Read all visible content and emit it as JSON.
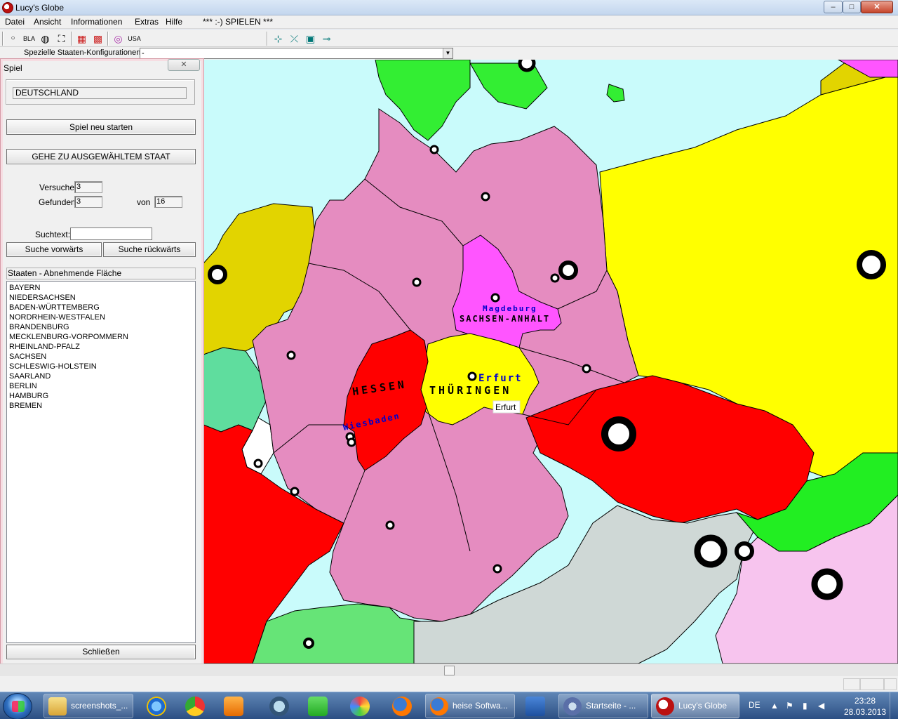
{
  "window": {
    "title": "Lucy's Globe",
    "minimize_glyph": "–",
    "maximize_glyph": "□",
    "close_glyph": "✕"
  },
  "menu": {
    "items": [
      "Datei",
      "Ansicht",
      "Informationen",
      "Extras",
      "Hilfe",
      "*** :-) SPIELEN ***"
    ]
  },
  "toolbar": {
    "buttons": [
      "○",
      "BLA",
      "◍",
      "⛶",
      "▦",
      "▩",
      "◎",
      "USA",
      "⊹",
      "⤫",
      "▣",
      "⊸"
    ]
  },
  "config": {
    "label": "Spezielle Staaten-Konfigurationen:",
    "value": "-",
    "arrow": "▼"
  },
  "panel": {
    "title": "Spiel",
    "close_glyph": "✕",
    "country": "DEUTSCHLAND",
    "restart_button": "Spiel neu starten",
    "goto_button": "GEHE ZU AUSGEWÄHLTEM STAAT",
    "attempts_label": "Versuche",
    "attempts_value": "3",
    "found_label": "Gefunden",
    "found_value": "3",
    "of_label": "von",
    "of_value": "16",
    "search_label": "Suchtext:",
    "search_value": "",
    "search_forward": "Suche vorwärts",
    "search_backward": "Suche rückwärts",
    "list_header": "Staaten - Abnehmende Fläche",
    "states": [
      "BAYERN",
      "NIEDERSACHSEN",
      "BADEN-WÜRTTEMBERG",
      "NORDRHEIN-WESTFALEN",
      "BRANDENBURG",
      "MECKLENBURG-VORPOMMERN",
      "RHEINLAND-PFALZ",
      "SACHSEN",
      "SCHLESWIG-HOLSTEIN",
      "SAARLAND",
      "BERLIN",
      "HAMBURG",
      "BREMEN"
    ],
    "close_button": "Schließen"
  },
  "map": {
    "labels": {
      "hessen": "HESSEN",
      "wiesbaden": "Wiesbaden",
      "thueringen": "THÜRINGEN",
      "erfurt": "Erfurt",
      "erfurt_tooltip": "Erfurt",
      "magdeburg": "Magdeburg",
      "sachsen_anhalt": "SACHSEN-ANHALT"
    },
    "colors": {
      "sea": "#c9fbfb",
      "germany_states": "#e58cc0",
      "found_sachsen_anhalt": "#ff55ff",
      "found_hessen": "#ff0000",
      "found_thueringen": "#ffff00",
      "poland": "#ffff00",
      "czechia": "#ff0000",
      "netherlands": "#e2d400",
      "belgium": "#5fdd9e",
      "denmark": "#33ee33",
      "austria": "#cfd8d6",
      "switzerland": "#66e477",
      "france": "#ff0000",
      "luxembourg": "#ffffff",
      "slovakia": "#22ee22",
      "hungary": "#f7c4ee",
      "capital_label": "#0000cc"
    }
  },
  "taskbar": {
    "items": [
      "screenshots_...",
      "heise Softwa...",
      "Startseite - ...",
      "Lucy's Globe"
    ],
    "language": "DE",
    "time": "23:28",
    "date": "28.03.2013"
  }
}
